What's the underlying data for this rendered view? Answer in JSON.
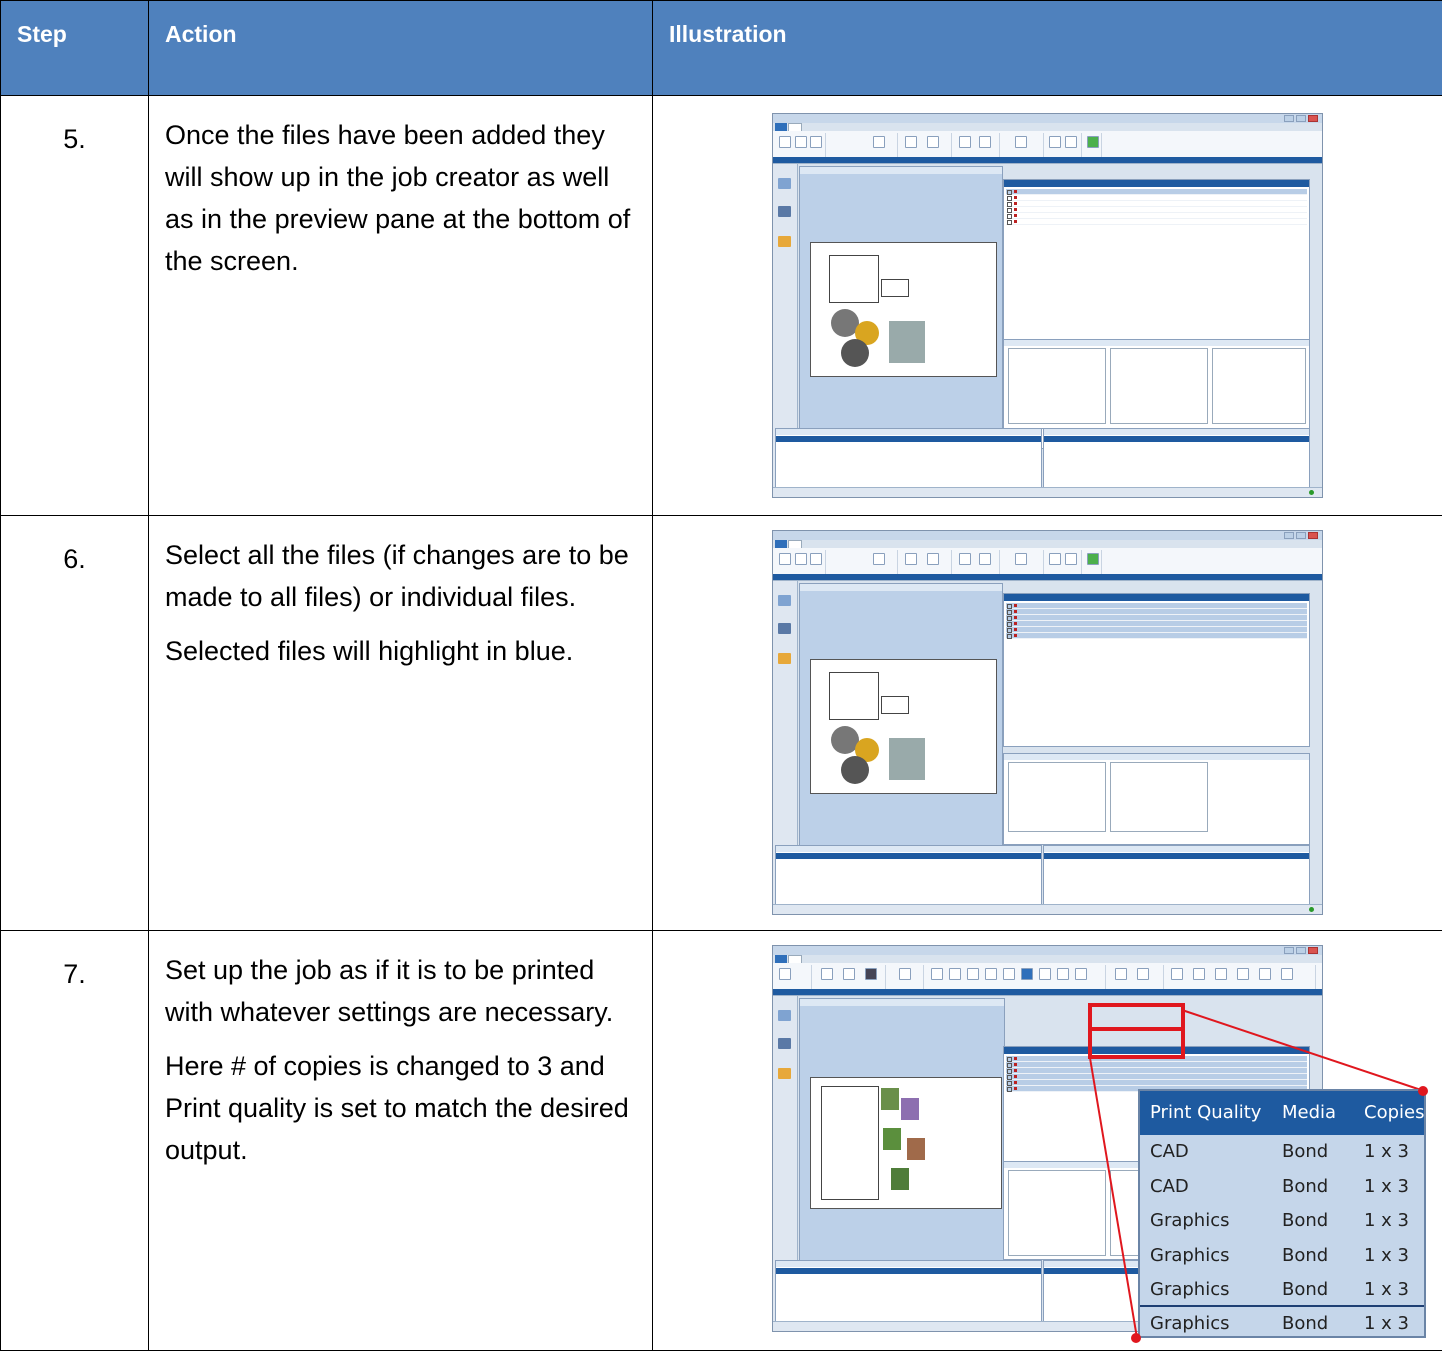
{
  "header": {
    "step": "Step",
    "action": "Action",
    "illustration": "Illustration"
  },
  "rows": [
    {
      "step": "5.",
      "paragraphs": [
        "Once the files have been added they will show up in the job creator as well as in the preview pane at the bottom of the screen."
      ]
    },
    {
      "step": "6.",
      "paragraphs": [
        "Select all the files (if changes are to be made to all files) or individual files.",
        "Selected files will highlight in blue."
      ]
    },
    {
      "step": "7.",
      "paragraphs": [
        "Set up the job as if it is to be printed with whatever settings are necessary.",
        "Here # of copies is changed to 3 and Print quality is set to match the desired output."
      ]
    }
  ],
  "zoom_table": {
    "headers": [
      "Print Quality",
      "Media",
      "Copies"
    ],
    "rows": [
      [
        "CAD",
        "Bond",
        "1 x 3"
      ],
      [
        "CAD",
        "Bond",
        "1 x 3"
      ],
      [
        "Graphics",
        "Bond",
        "1 x 3"
      ],
      [
        "Graphics",
        "Bond",
        "1 x 3"
      ],
      [
        "Graphics",
        "Bond",
        "1 x 3"
      ],
      [
        "Graphics",
        "Bond",
        "1 x 3"
      ]
    ]
  },
  "colors": {
    "header_bg": "#4f81bd",
    "callout_red": "#e0171e",
    "app_blue": "#1e5aa0"
  }
}
